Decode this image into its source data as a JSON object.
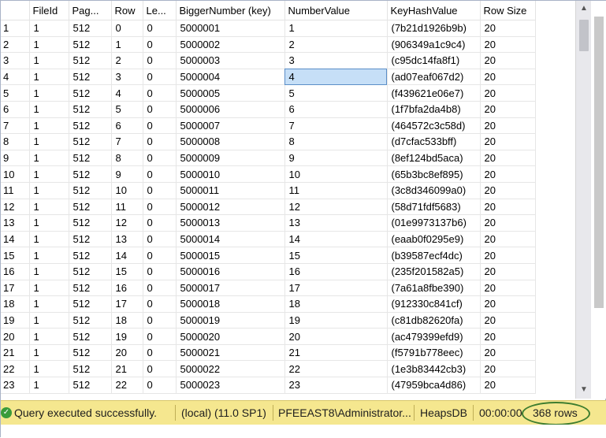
{
  "grid": {
    "columns": [
      "",
      "FileId",
      "Pag...",
      "Row",
      "Le...",
      "BiggerNumber (key)",
      "NumberValue",
      "KeyHashValue",
      "Row Size"
    ],
    "selected_row": 3,
    "selected_col": 6,
    "rows": [
      [
        "1",
        "1",
        "512",
        "0",
        "0",
        "5000001",
        "1",
        "(7b21d1926b9b)",
        "20"
      ],
      [
        "2",
        "1",
        "512",
        "1",
        "0",
        "5000002",
        "2",
        "(906349a1c9c4)",
        "20"
      ],
      [
        "3",
        "1",
        "512",
        "2",
        "0",
        "5000003",
        "3",
        "(c95dc14fa8f1)",
        "20"
      ],
      [
        "4",
        "1",
        "512",
        "3",
        "0",
        "5000004",
        "4",
        "(ad07eaf067d2)",
        "20"
      ],
      [
        "5",
        "1",
        "512",
        "4",
        "0",
        "5000005",
        "5",
        "(f439621e06e7)",
        "20"
      ],
      [
        "6",
        "1",
        "512",
        "5",
        "0",
        "5000006",
        "6",
        "(1f7bfa2da4b8)",
        "20"
      ],
      [
        "7",
        "1",
        "512",
        "6",
        "0",
        "5000007",
        "7",
        "(464572c3c58d)",
        "20"
      ],
      [
        "8",
        "1",
        "512",
        "7",
        "0",
        "5000008",
        "8",
        "(d7cfac533bff)",
        "20"
      ],
      [
        "9",
        "1",
        "512",
        "8",
        "0",
        "5000009",
        "9",
        "(8ef124bd5aca)",
        "20"
      ],
      [
        "10",
        "1",
        "512",
        "9",
        "0",
        "5000010",
        "10",
        "(65b3bc8ef895)",
        "20"
      ],
      [
        "11",
        "1",
        "512",
        "10",
        "0",
        "5000011",
        "11",
        "(3c8d346099a0)",
        "20"
      ],
      [
        "12",
        "1",
        "512",
        "11",
        "0",
        "5000012",
        "12",
        "(58d71fdf5683)",
        "20"
      ],
      [
        "13",
        "1",
        "512",
        "12",
        "0",
        "5000013",
        "13",
        "(01e9973137b6)",
        "20"
      ],
      [
        "14",
        "1",
        "512",
        "13",
        "0",
        "5000014",
        "14",
        "(eaab0f0295e9)",
        "20"
      ],
      [
        "15",
        "1",
        "512",
        "14",
        "0",
        "5000015",
        "15",
        "(b39587ecf4dc)",
        "20"
      ],
      [
        "16",
        "1",
        "512",
        "15",
        "0",
        "5000016",
        "16",
        "(235f201582a5)",
        "20"
      ],
      [
        "17",
        "1",
        "512",
        "16",
        "0",
        "5000017",
        "17",
        "(7a61a8fbe390)",
        "20"
      ],
      [
        "18",
        "1",
        "512",
        "17",
        "0",
        "5000018",
        "18",
        "(912330c841cf)",
        "20"
      ],
      [
        "19",
        "1",
        "512",
        "18",
        "0",
        "5000019",
        "19",
        "(c81db82620fa)",
        "20"
      ],
      [
        "20",
        "1",
        "512",
        "19",
        "0",
        "5000020",
        "20",
        "(ac479399efd9)",
        "20"
      ],
      [
        "21",
        "1",
        "512",
        "20",
        "0",
        "5000021",
        "21",
        "(f5791b778eec)",
        "20"
      ],
      [
        "22",
        "1",
        "512",
        "21",
        "0",
        "5000022",
        "22",
        "(1e3b83442cb3)",
        "20"
      ],
      [
        "23",
        "1",
        "512",
        "22",
        "0",
        "5000023",
        "23",
        "(47959bca4d86)",
        "20"
      ]
    ]
  },
  "scrollbar": {
    "up_icon": "chevron-up-icon",
    "down_icon": "chevron-down-icon"
  },
  "status": {
    "icon": "check-circle-icon",
    "message": "Query executed successfully.",
    "server": "(local) (11.0 SP1)",
    "user": "PFEEAST8\\Administrator...",
    "database": "HeapsDB",
    "elapsed": "00:00:00",
    "rows": "368 rows",
    "bar_color": "#f5e78f",
    "highlight_color": "#3d7d2f"
  }
}
